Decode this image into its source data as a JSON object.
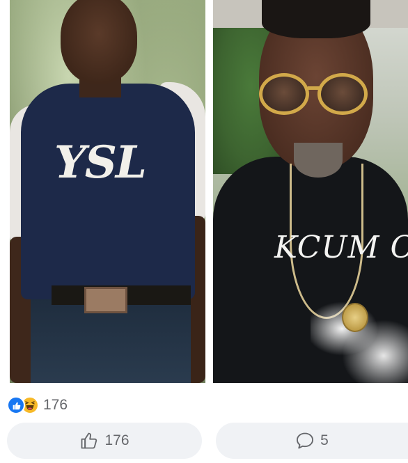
{
  "post": {
    "photos": {
      "left": {
        "shirt_text": "YSL"
      },
      "right": {
        "shirt_text": "KCUM CLUB"
      }
    },
    "reactions": {
      "icons": [
        "like-icon",
        "haha-icon"
      ],
      "count": "176"
    },
    "actions": {
      "like_count": "176",
      "comment_count": "5"
    }
  },
  "colors": {
    "like_blue": "#1877f2",
    "haha_yellow": "#f7b928",
    "button_bg": "#f0f2f5",
    "muted_text": "#65676b"
  }
}
